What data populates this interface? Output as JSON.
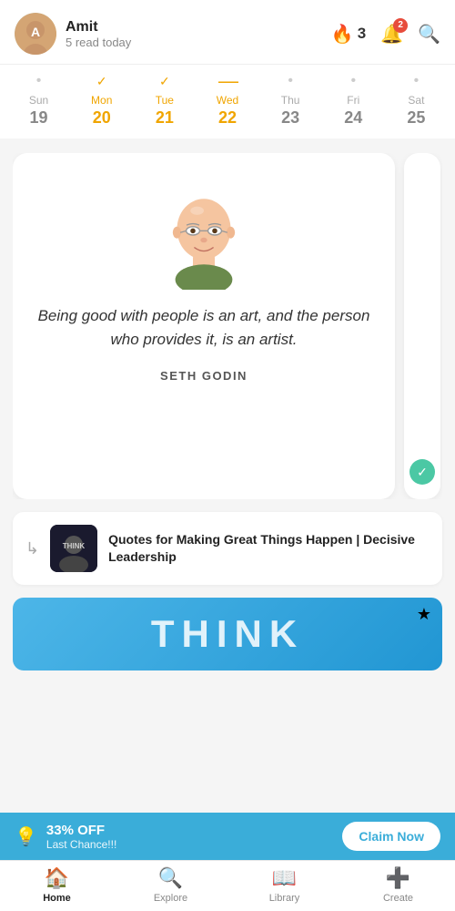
{
  "header": {
    "user_name": "Amit",
    "user_sub": "5 read today",
    "streak": 3,
    "notif_count": 2
  },
  "calendar": {
    "days": [
      {
        "name": "Sun",
        "num": "19",
        "state": "normal",
        "marker": "dot"
      },
      {
        "name": "Mon",
        "num": "20",
        "state": "active",
        "marker": "check"
      },
      {
        "name": "Tue",
        "num": "21",
        "state": "active",
        "marker": "check"
      },
      {
        "name": "Wed",
        "num": "22",
        "state": "active",
        "marker": "dash"
      },
      {
        "name": "Thu",
        "num": "23",
        "state": "normal",
        "marker": "dot"
      },
      {
        "name": "Fri",
        "num": "24",
        "state": "normal",
        "marker": "dot"
      },
      {
        "name": "Sat",
        "num": "25",
        "state": "normal",
        "marker": "dot"
      }
    ]
  },
  "quote_card": {
    "quote": "Being good with people is an art, and the person who provides it, is an artist.",
    "author": "SETH GODIN"
  },
  "related": {
    "arrow": "↳",
    "title": "Quotes for Making Great Things Happen | Decisive Leadership"
  },
  "think_banner": {
    "text": "THINK",
    "star": "★"
  },
  "promo": {
    "icon": "💡",
    "title": "33% OFF",
    "subtitle": "Last Chance!!!",
    "cta": "Claim Now"
  },
  "nav": [
    {
      "icon": "🏠",
      "label": "Home",
      "active": true
    },
    {
      "icon": "🔍",
      "label": "Explore",
      "active": false
    },
    {
      "icon": "📚",
      "label": "Library",
      "active": false
    },
    {
      "icon": "➕",
      "label": "Create",
      "active": false
    }
  ]
}
